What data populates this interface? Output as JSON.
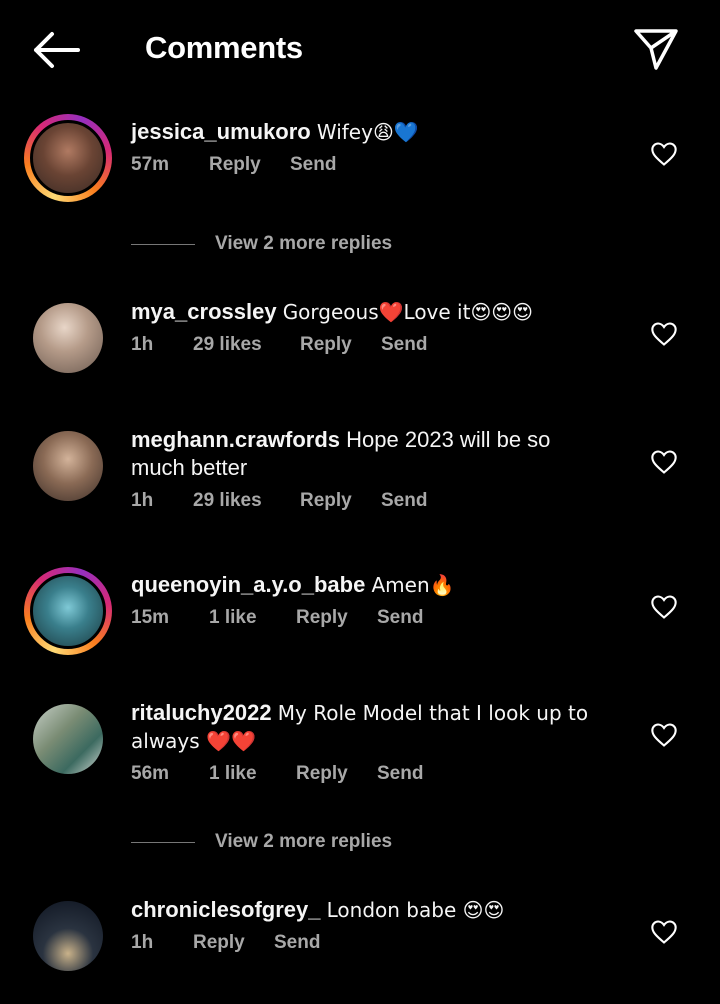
{
  "header": {
    "title": "Comments",
    "back_icon": "arrow-left-icon",
    "send_icon": "paper-plane-icon"
  },
  "view_more_label": "View 2 more replies",
  "comments": [
    {
      "username": "jessica_umukoro",
      "text": "Wifey😩💙",
      "time": "57m",
      "likes": "",
      "reply": "Reply",
      "send": "Send",
      "story_ring": true
    },
    {
      "username": "mya_crossley",
      "text": "Gorgeous❤️Love it😍😍😍",
      "time": "1h",
      "likes": "29 likes",
      "reply": "Reply",
      "send": "Send",
      "story_ring": false
    },
    {
      "username": "meghann.crawfords",
      "text": "Hope 2023 will be so much better",
      "time": "1h",
      "likes": "29 likes",
      "reply": "Reply",
      "send": "Send",
      "story_ring": false
    },
    {
      "username": "queenoyin_a.y.o_babe",
      "text": "Amen🔥",
      "time": "15m",
      "likes": "1 like",
      "reply": "Reply",
      "send": "Send",
      "story_ring": true
    },
    {
      "username": "ritaluchy2022",
      "text": "My Role Model that I look up to always ❤️❤️",
      "time": "56m",
      "likes": "1 like",
      "reply": "Reply",
      "send": "Send",
      "story_ring": false
    },
    {
      "username": "chroniclesofgrey_",
      "text": "London babe 😍😍",
      "time": "1h",
      "likes": "",
      "reply": "Reply",
      "send": "Send",
      "story_ring": false
    }
  ],
  "colors": {
    "background": "#000000",
    "text": "#f5f5f5",
    "secondary": "#a8a8a8"
  }
}
